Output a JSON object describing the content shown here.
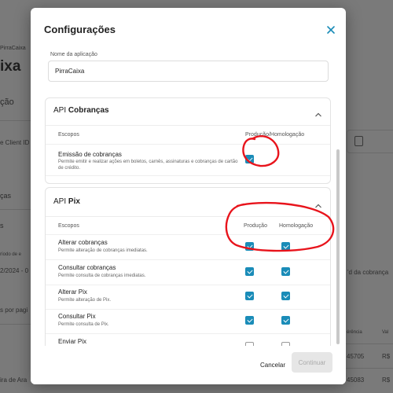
{
  "background_page": {
    "breadcrumb": "PirraCaixa",
    "title_fragment": "ixa",
    "section_fragment": "ção",
    "client_id_label": "e Client ID",
    "side_fragment": "ças",
    "side_fragment2": "s",
    "date_fragment_label": "ríodo de e",
    "date_fragment": "2/2024 - 0",
    "per_page": "s por pagi",
    "right_link": "'d da cobrança",
    "col_fragment": "érência",
    "col_fragment2": "Val",
    "row1_id": "45705",
    "row1_val": "R$",
    "row2_name": "ira de Ara",
    "row2_id": "45083",
    "row2_val": "R$"
  },
  "modal": {
    "title": "Configurações",
    "app_name_label": "Nome da aplicação",
    "app_name_value": "PirraCaixa",
    "cobrancas_section": {
      "title_prefix": "API",
      "title_bold": "Cobranças",
      "col_scopes": "Escopos",
      "col_env": "Produção/Homologação",
      "rows": [
        {
          "title": "Emissão de cobranças",
          "desc": "Permite emitir e realizar ações em boletos, carnês, assinaturas e cobranças de cartão de crédito.",
          "checked": true
        }
      ]
    },
    "pix_section": {
      "title_prefix": "API",
      "title_bold": "Pix",
      "col_scopes": "Escopos",
      "col_prod": "Produção",
      "col_homol": "Homologação",
      "rows": [
        {
          "title": "Alterar cobranças",
          "desc": "Permite alteração de cobranças imediatas.",
          "prod": true,
          "homol": true
        },
        {
          "title": "Consultar cobranças",
          "desc": "Permite consulta de cobranças imediatas.",
          "prod": true,
          "homol": true
        },
        {
          "title": "Alterar Pix",
          "desc": "Permite alteração de Pix.",
          "prod": true,
          "homol": true
        },
        {
          "title": "Consultar Pix",
          "desc": "Permite consulta de Pix.",
          "prod": true,
          "homol": true
        },
        {
          "title": "Enviar Pix",
          "desc": "",
          "prod": false,
          "homol": false
        }
      ]
    },
    "footer": {
      "cancel_label": "Cancelar",
      "continue_label": "Continuar"
    }
  },
  "colors": {
    "accent": "#1a8cb8",
    "annotation": "#e8141c",
    "overlay": "#7a7a7a"
  }
}
